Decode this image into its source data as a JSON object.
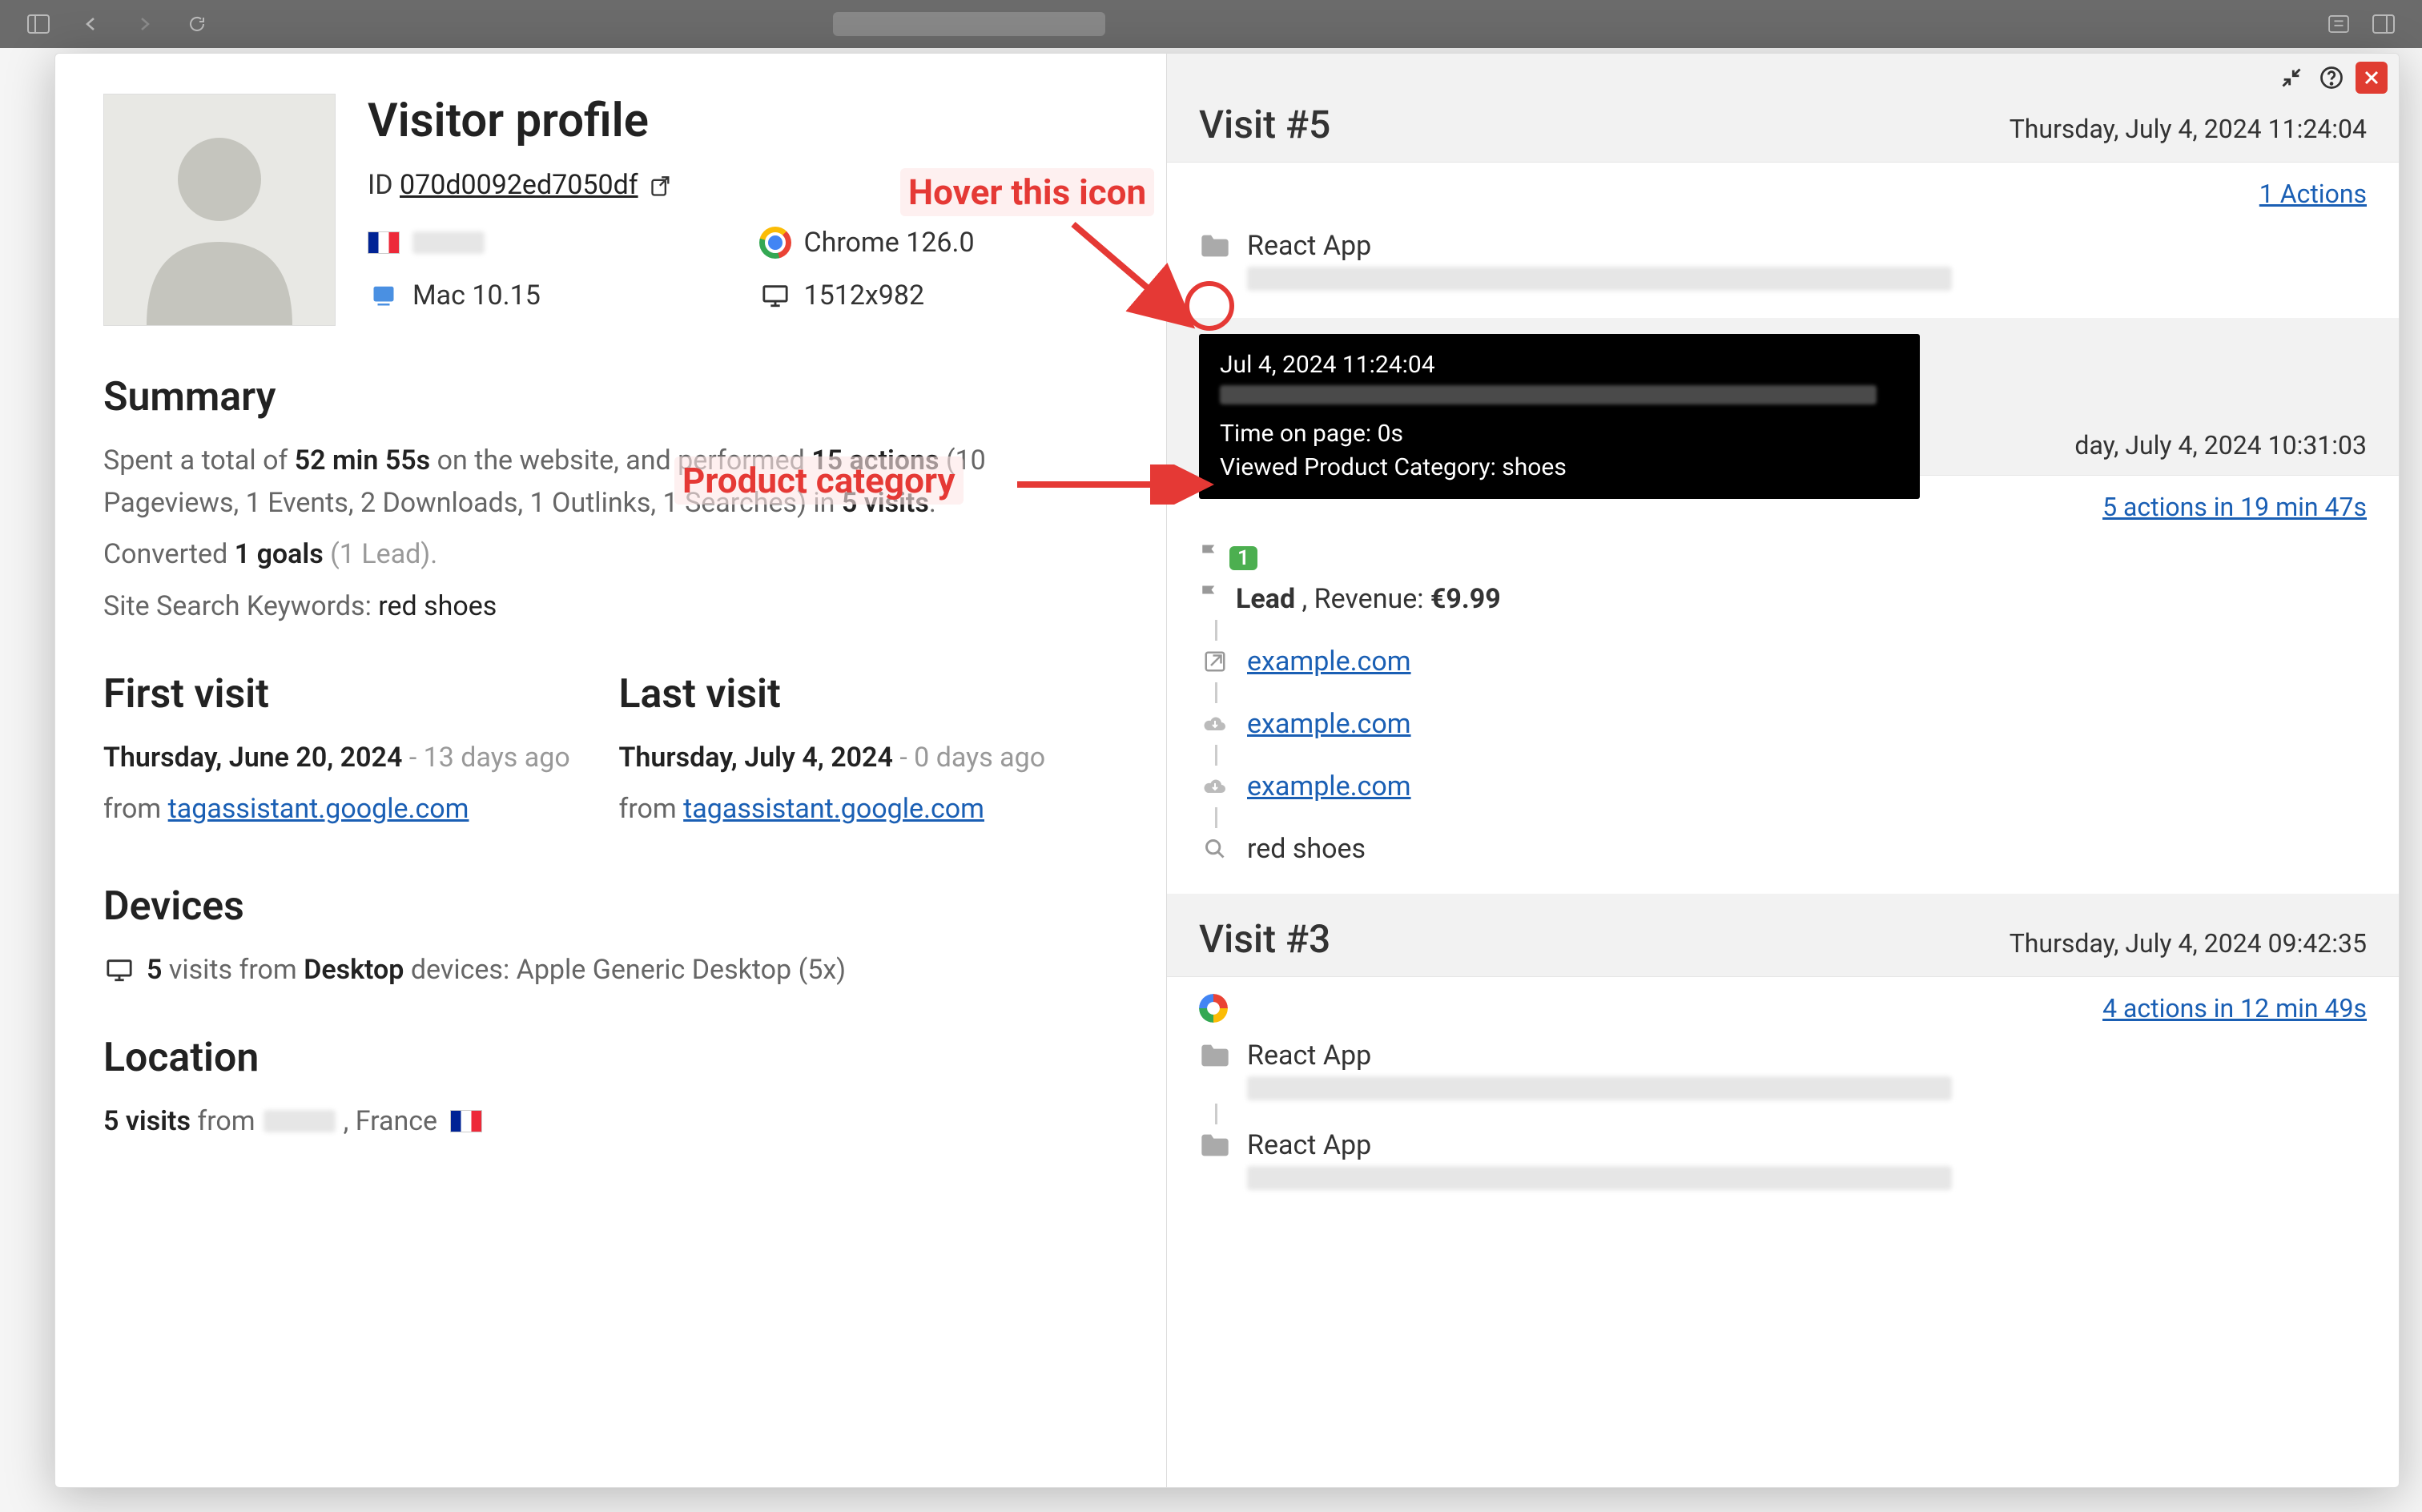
{
  "profile": {
    "title": "Visitor profile",
    "id_label": "ID",
    "id": "070d0092ed7050df",
    "browser": "Chrome 126.0",
    "os": "Mac 10.15",
    "resolution": "1512x982"
  },
  "summary": {
    "heading": "Summary",
    "line1_pre": "Spent a total of ",
    "duration": "52 min 55s",
    "line1_mid": " on the website, and performed ",
    "actions": "15 actions",
    "line1_post": " (10 Pageviews, 1 Events, 2 Downloads, 1 Outlinks, 1 Searches) in ",
    "visits": "5 visits",
    "line1_end": ".",
    "line2_pre": "Converted ",
    "goals": "1 goals",
    "line2_post": " (1 Lead).",
    "line3_pre": "Site Search Keywords: ",
    "keywords": "red shoes"
  },
  "first_visit": {
    "heading": "First visit",
    "date": "Thursday, June 20, 2024",
    "ago": " - 13 days ago",
    "from": "from ",
    "referrer": "tagassistant.google.com"
  },
  "last_visit": {
    "heading": "Last visit",
    "date": "Thursday, July 4, 2024",
    "ago": " - 0 days ago",
    "from": "from ",
    "referrer": "tagassistant.google.com"
  },
  "devices": {
    "heading": "Devices",
    "count": "5",
    "text_mid": " visits from ",
    "device": "Desktop",
    "text_post": " devices: Apple Generic Desktop (5x)"
  },
  "location": {
    "heading": "Location",
    "count": "5 visits",
    "from": " from ",
    "country": ", France"
  },
  "visits": {
    "v5": {
      "title": "Visit #5",
      "time": "Thursday, July 4, 2024 11:24:04",
      "actions_link": "1 Actions",
      "page_name": "React App"
    },
    "v4": {
      "time": "day, July 4, 2024 10:31:03",
      "actions_link": "5 actions in 19 min 47s",
      "goal_count": "1",
      "lead": "Lead",
      "revenue_label": " , Revenue: ",
      "revenue": "€9.99",
      "link1": "example.com",
      "link2": "example.com",
      "link3": "example.com",
      "search": "red shoes"
    },
    "v3": {
      "title": "Visit #3",
      "time": "Thursday, July 4, 2024 09:42:35",
      "actions_link": "4 actions in 12 min 49s",
      "page_name": "React App",
      "page_name2": "React App"
    }
  },
  "tooltip": {
    "line1": "Jul 4, 2024 11:24:04",
    "line3": "Time on page: 0s",
    "line4": "Viewed Product Category: shoes"
  },
  "annotations": {
    "hover": "Hover this icon",
    "category": "Product category"
  }
}
